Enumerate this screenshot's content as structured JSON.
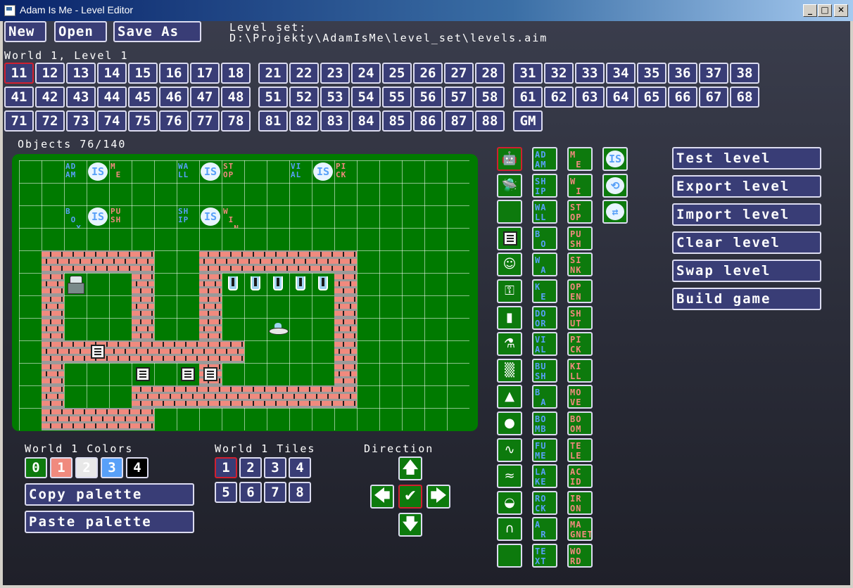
{
  "window": {
    "title": "Adam Is Me - Level Editor",
    "min": "_",
    "max": "□",
    "close": "✕"
  },
  "toolbar": {
    "new_label": "New",
    "open_label": "Open",
    "save_as_label": "Save As"
  },
  "level_set": {
    "label": "Level set:",
    "path": "D:\\Projekty\\AdamIsMe\\level_set\\levels.aim"
  },
  "current_level_label": "World 1, Level 1",
  "levels": {
    "row1": [
      "11",
      "12",
      "13",
      "14",
      "15",
      "16",
      "17",
      "18",
      "21",
      "22",
      "23",
      "24",
      "25",
      "26",
      "27",
      "28",
      "31",
      "32",
      "33",
      "34",
      "35",
      "36",
      "37",
      "38"
    ],
    "row2": [
      "41",
      "42",
      "43",
      "44",
      "45",
      "46",
      "47",
      "48",
      "51",
      "52",
      "53",
      "54",
      "55",
      "56",
      "57",
      "58",
      "61",
      "62",
      "63",
      "64",
      "65",
      "66",
      "67",
      "68"
    ],
    "row3": [
      "71",
      "72",
      "73",
      "74",
      "75",
      "76",
      "77",
      "78",
      "81",
      "82",
      "83",
      "84",
      "85",
      "86",
      "87",
      "88",
      "GM"
    ],
    "selected": "11"
  },
  "objects_label": "Objects 76/140",
  "board_words": {
    "adam": "AD\nAM",
    "is": "IS",
    "me": "M\n E",
    "wall": "WA\nLL",
    "stop": "ST\nOP",
    "vial": "VI\nAL",
    "pick": "PI\nCK",
    "box": "B\n O\n  X",
    "push": "PU\nSH",
    "ship": "SH\nIP",
    "win": "W\n I\n  N"
  },
  "colors": {
    "label": "World 1 Colors",
    "swatches": [
      "0",
      "1",
      "2",
      "3",
      "4"
    ],
    "copy": "Copy palette",
    "paste": "Paste palette"
  },
  "tiles": {
    "label": "World 1 Tiles",
    "items": [
      "1",
      "2",
      "3",
      "4",
      "5",
      "6",
      "7",
      "8"
    ],
    "selected": "1"
  },
  "direction": {
    "label": "Direction",
    "up": "🡅",
    "left": "🡄",
    "center": "✔",
    "right": "🡆",
    "down": "🡇"
  },
  "palette": {
    "nouns": [
      "AD\nAM",
      "SH\nIP",
      "WA\nLL",
      "B\n O\n  X",
      "W\n A\n  D",
      "K\n E\n  Y",
      "DO\nOR",
      "VI\nAL",
      "BU\nSH",
      "B\n A\n  T",
      "BO\nMB",
      "FU\nME",
      "LA\nKE",
      "RO\nCK",
      "A\n R\n  C",
      "TE\nXT"
    ],
    "props": [
      "M\n E",
      "W\n I\n  N",
      "ST\nOP",
      "PU\nSH",
      "SI\nNK",
      "OP\nEN",
      "SH\nUT",
      "PI\nCK",
      "KI\nLL",
      "MO\nVE",
      "BO\nOM",
      "TE\nLE",
      "AC\nID",
      "IR\nON",
      "MA\nGNET",
      "WO\nRD"
    ],
    "ops": [
      "IS",
      "⟲",
      "⇄"
    ]
  },
  "actions": [
    "Test level",
    "Export level",
    "Import level",
    "Clear level",
    "Swap level",
    "Build game"
  ]
}
